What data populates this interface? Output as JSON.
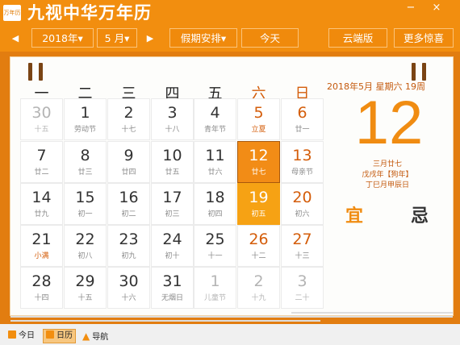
{
  "window": {
    "icon_text": "万年历",
    "title": "九视中华万年历",
    "minimize": "−",
    "close": "×"
  },
  "toolbar": {
    "prev": "◀",
    "year": "2018年▾",
    "month": "5 月▾",
    "next": "▶",
    "holiday": "假期安排▾",
    "today": "今天",
    "cloud": "云端版",
    "more": "更多惊喜"
  },
  "weekdays": [
    "一",
    "二",
    "三",
    "四",
    "五",
    "六",
    "日"
  ],
  "calendar": {
    "rows": [
      [
        {
          "day": "30",
          "lunar": "十五",
          "kind": "other"
        },
        {
          "day": "1",
          "lunar": "劳动节",
          "kind": "normal"
        },
        {
          "day": "2",
          "lunar": "十七",
          "kind": "normal"
        },
        {
          "day": "3",
          "lunar": "十八",
          "kind": "normal"
        },
        {
          "day": "4",
          "lunar": "青年节",
          "kind": "normal"
        },
        {
          "day": "5",
          "lunar": "立夏",
          "kind": "weekend",
          "term": true
        },
        {
          "day": "6",
          "lunar": "廿一",
          "kind": "weekend"
        }
      ],
      [
        {
          "day": "7",
          "lunar": "廿二",
          "kind": "normal"
        },
        {
          "day": "8",
          "lunar": "廿三",
          "kind": "normal"
        },
        {
          "day": "9",
          "lunar": "廿四",
          "kind": "normal"
        },
        {
          "day": "10",
          "lunar": "廿五",
          "kind": "normal"
        },
        {
          "day": "11",
          "lunar": "廿六",
          "kind": "normal"
        },
        {
          "day": "12",
          "lunar": "廿七",
          "kind": "selected"
        },
        {
          "day": "13",
          "lunar": "母亲节",
          "kind": "weekend"
        }
      ],
      [
        {
          "day": "14",
          "lunar": "廿九",
          "kind": "normal"
        },
        {
          "day": "15",
          "lunar": "初一",
          "kind": "normal"
        },
        {
          "day": "16",
          "lunar": "初二",
          "kind": "normal"
        },
        {
          "day": "17",
          "lunar": "初三",
          "kind": "normal"
        },
        {
          "day": "18",
          "lunar": "初四",
          "kind": "normal"
        },
        {
          "day": "19",
          "lunar": "初五",
          "kind": "today"
        },
        {
          "day": "20",
          "lunar": "初六",
          "kind": "weekend"
        }
      ],
      [
        {
          "day": "21",
          "lunar": "小满",
          "kind": "normal",
          "term": true
        },
        {
          "day": "22",
          "lunar": "初八",
          "kind": "normal"
        },
        {
          "day": "23",
          "lunar": "初九",
          "kind": "normal"
        },
        {
          "day": "24",
          "lunar": "初十",
          "kind": "normal"
        },
        {
          "day": "25",
          "lunar": "十一",
          "kind": "normal"
        },
        {
          "day": "26",
          "lunar": "十二",
          "kind": "weekend"
        },
        {
          "day": "27",
          "lunar": "十三",
          "kind": "weekend"
        }
      ],
      [
        {
          "day": "28",
          "lunar": "十四",
          "kind": "normal"
        },
        {
          "day": "29",
          "lunar": "十五",
          "kind": "normal"
        },
        {
          "day": "30",
          "lunar": "十六",
          "kind": "normal"
        },
        {
          "day": "31",
          "lunar": "无烟日",
          "kind": "normal"
        },
        {
          "day": "1",
          "lunar": "儿童节",
          "kind": "other"
        },
        {
          "day": "2",
          "lunar": "十九",
          "kind": "other"
        },
        {
          "day": "3",
          "lunar": "二十",
          "kind": "other"
        }
      ]
    ]
  },
  "detail": {
    "header": "2018年5月  星期六  19周",
    "big_day": "12",
    "lunar_date": "三月廿七",
    "ganzhi_year": "戊戌年【狗年】",
    "ganzhi_day": "丁巳月甲辰日",
    "yi": "宜",
    "ji": "忌"
  },
  "statusbar": {
    "today": "今日",
    "calendar": "日历",
    "nav": "导航"
  }
}
